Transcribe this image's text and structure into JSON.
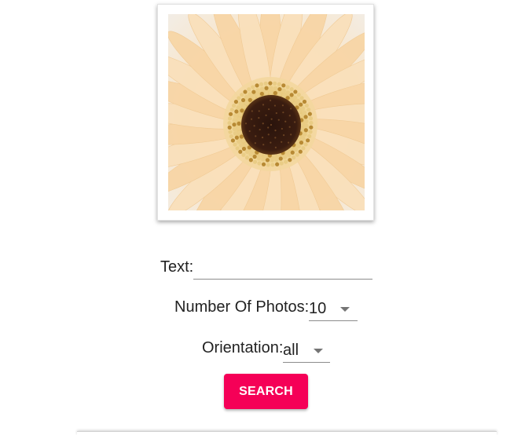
{
  "photo": {
    "image_description": "close-up of a peach gerbera daisy with a dark center"
  },
  "form": {
    "text_label": "Text:",
    "text_value": "",
    "count_label": "Number Of Photos:",
    "count_value": "10",
    "orientation_label": "Orientation:",
    "orientation_value": "all"
  },
  "actions": {
    "search_label": "SEARCH"
  },
  "colors": {
    "accent": "#f50057"
  }
}
